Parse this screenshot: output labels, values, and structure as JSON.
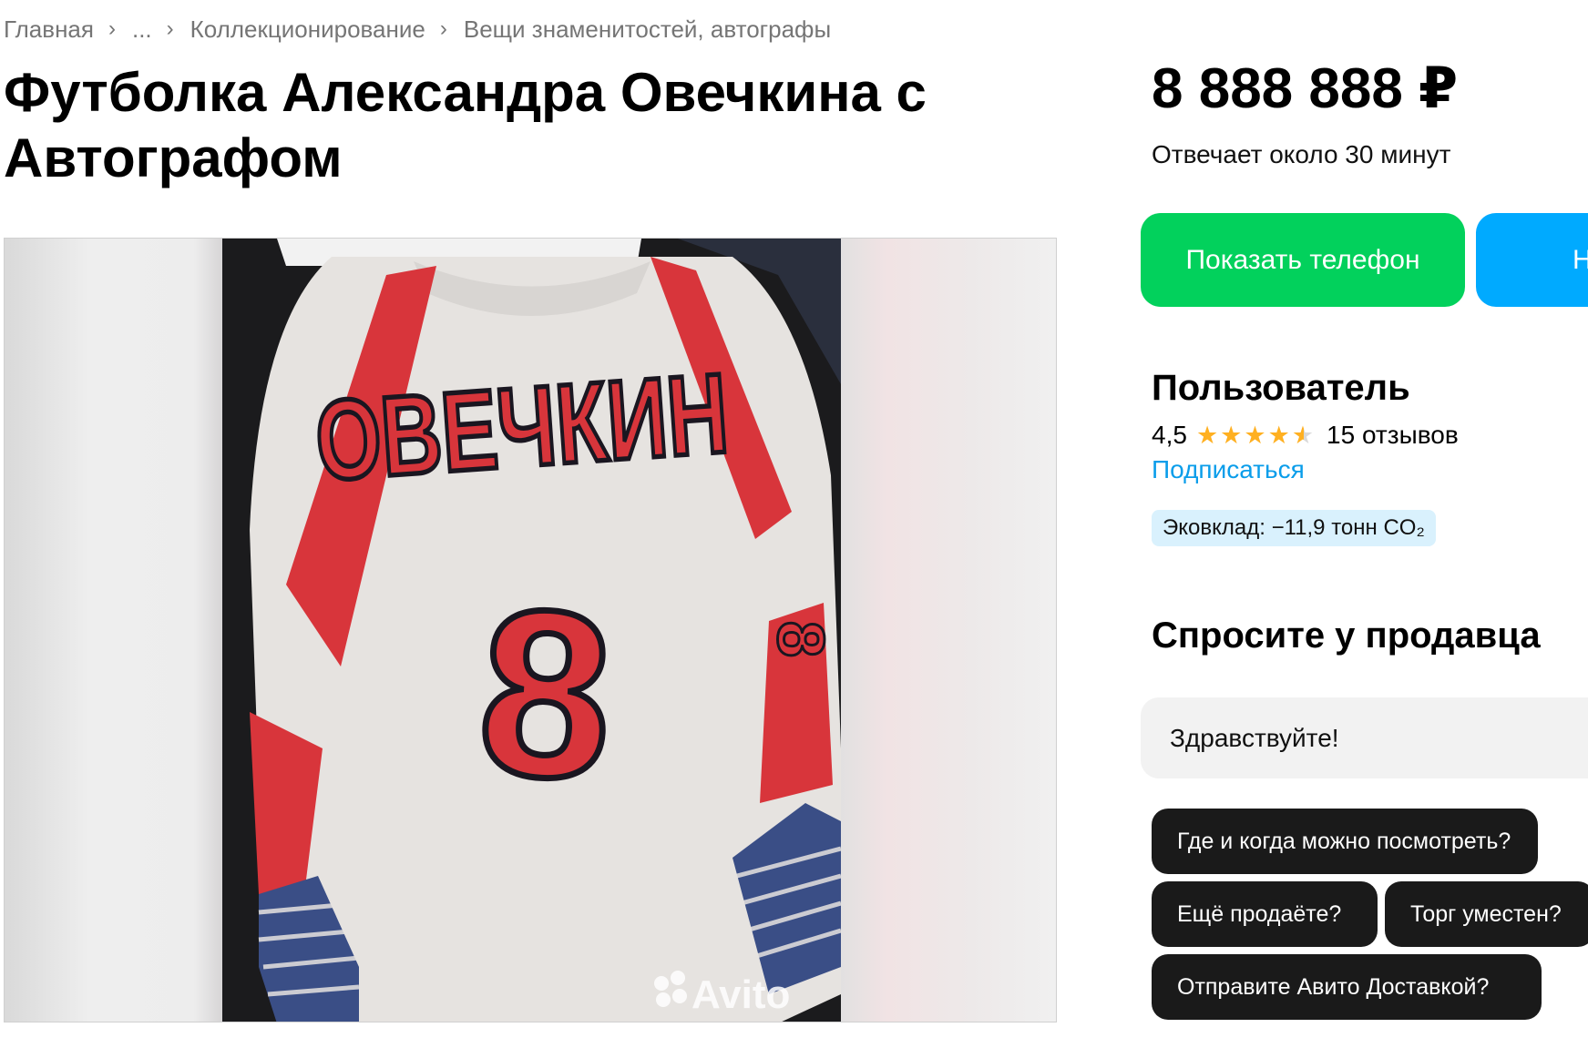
{
  "breadcrumb": {
    "items": [
      "Главная",
      "...",
      "Коллекционирование",
      "Вещи знаменитостей, автографы"
    ],
    "separator": "›"
  },
  "listing": {
    "title": "Футболка Александра Овечкина с Автографом",
    "photo": {
      "jersey_name": "ОВЕЧКИН",
      "jersey_number": "8",
      "watermark": "Avito",
      "colors": {
        "jersey": "#e6e3e0",
        "accent": "#d8353b",
        "outline": "#1a1620",
        "stripes": "#3a4e86"
      }
    }
  },
  "price": "8 888 888 ₽",
  "reply_time": "Отвечает около 30 минут",
  "actions": {
    "show_phone": "Показать телефон",
    "write": "Н"
  },
  "seller": {
    "name": "Пользователь",
    "rating": "4,5",
    "rating_value": 4.5,
    "stars_max": 5,
    "reviews": "15 отзывов",
    "subscribe": "Подписаться",
    "eco_badge": "Эковклад: −11,9 тонн CO₂"
  },
  "ask": {
    "title": "Спросите у продавца",
    "input_value": "Здравствуйте!",
    "quick_questions": [
      "Где и когда можно посмотреть?",
      "Ещё продаёте?",
      "Торг уместен?",
      "Отправите Авито Доставкой?"
    ]
  },
  "colors": {
    "phone_button": "#02d15c",
    "write_button": "#00aaff",
    "link": "#0a9dea",
    "star": "#ffb021",
    "eco_badge_bg": "#d9f1fd",
    "chip_bg": "#1a1a1a"
  },
  "icons": {
    "star": "star-icon",
    "star_half": "star-half-icon",
    "breadcrumb_separator": "chevron-right-icon"
  }
}
